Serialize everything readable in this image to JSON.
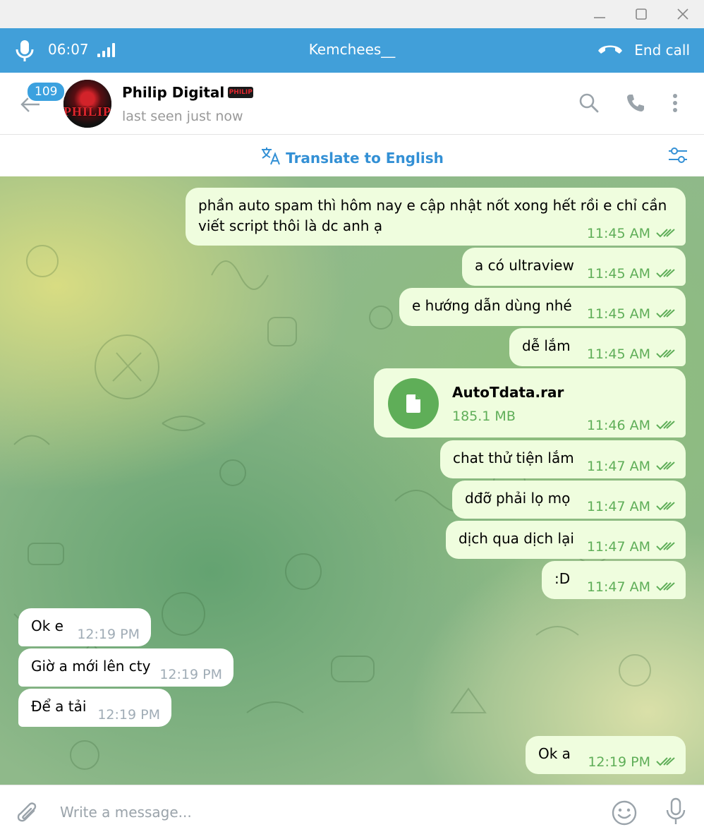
{
  "window": {
    "minimize_icon": "minimize-icon",
    "maximize_icon": "maximize-icon",
    "close_icon": "close-icon"
  },
  "call": {
    "duration": "06:07",
    "peer_name": "Kemchees__",
    "end_call_label": "End call",
    "icons": [
      "microphone-icon",
      "signal-icon",
      "phone-hangup-icon"
    ],
    "bar_color": "#419fd9"
  },
  "chat_header": {
    "unread_count": "109",
    "contact_name": "Philip Digital",
    "avatar_text": "PHILIP",
    "status": "last seen just now",
    "icons": [
      "back-arrow-icon",
      "search-icon",
      "phone-icon",
      "more-vertical-icon"
    ]
  },
  "translate": {
    "label": "Translate to English",
    "icons": [
      "translate-icon",
      "settings-sliders-icon"
    ],
    "color": "#3390d5"
  },
  "messages": [
    {
      "direction": "out",
      "lines": [
        "phần auto spam thì hôm nay e cập nhật nốt xong hết rồi e chỉ cần",
        "viết script thôi là dc anh ạ"
      ],
      "time": "11:45 AM"
    },
    {
      "direction": "out",
      "lines": [
        "a có ultraview"
      ],
      "time": "11:45 AM"
    },
    {
      "direction": "out",
      "lines": [
        "e hướng dẫn dùng nhé"
      ],
      "time": "11:45 AM"
    },
    {
      "direction": "out",
      "lines": [
        "dễ lắm"
      ],
      "time": "11:45 AM"
    },
    {
      "direction": "out",
      "type": "file",
      "file_name": "AutoTdata.rar",
      "file_size": "185.1 MB",
      "time": "11:46 AM"
    },
    {
      "direction": "out",
      "lines": [
        "chat thử tiện lắm"
      ],
      "time": "11:47 AM"
    },
    {
      "direction": "out",
      "lines": [
        "dđỡ phải lọ mọ"
      ],
      "time": "11:47 AM"
    },
    {
      "direction": "out",
      "lines": [
        "dịch qua dịch lại"
      ],
      "time": "11:47 AM"
    },
    {
      "direction": "out",
      "lines": [
        ":D"
      ],
      "time": "11:47 AM"
    },
    {
      "direction": "in",
      "lines": [
        "Ok e"
      ],
      "time": "12:19 PM"
    },
    {
      "direction": "in",
      "lines": [
        "Giờ a mới lên cty"
      ],
      "time": "12:19 PM"
    },
    {
      "direction": "in",
      "lines": [
        "Để a tải"
      ],
      "time": "12:19 PM"
    },
    {
      "direction": "out",
      "lines": [
        "Ok a"
      ],
      "time": "12:19 PM"
    }
  ],
  "composer": {
    "placeholder": "Write a message...",
    "icons": [
      "paperclip-icon",
      "emoji-icon",
      "microphone-icon"
    ]
  },
  "colors": {
    "outgoing_bubble": "#effdde",
    "incoming_bubble": "#ffffff",
    "read_ticks": "#5fae58"
  }
}
